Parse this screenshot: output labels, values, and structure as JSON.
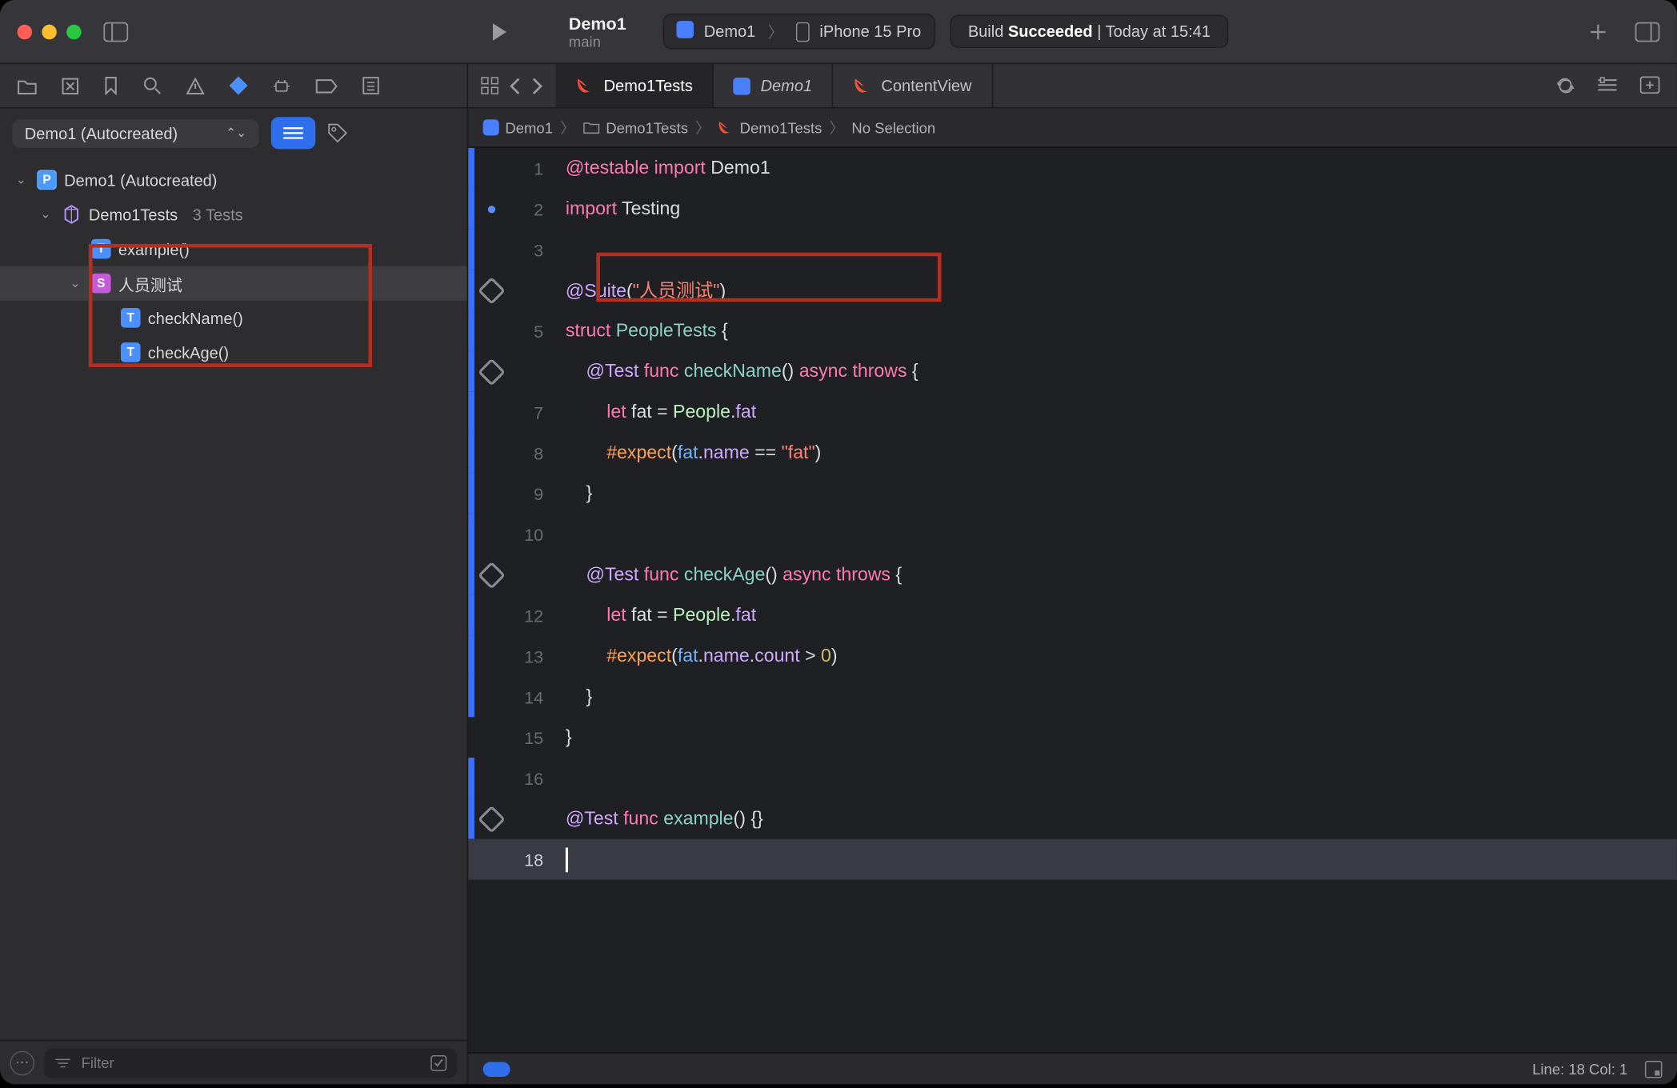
{
  "window": {
    "project": "Demo1",
    "branch": "main"
  },
  "scheme": {
    "target": "Demo1",
    "device": "iPhone 15 Pro"
  },
  "build_status": {
    "prefix": "Build ",
    "result": "Succeeded",
    "when": " | Today at 15:41"
  },
  "nav_dropdown": "Demo1 (Autocreated)",
  "tests_tree": {
    "root": "Demo1 (Autocreated)",
    "target": "Demo1Tests",
    "target_count": "3 Tests",
    "items": {
      "example": "example()",
      "suite": "人员测试",
      "checkName": "checkName()",
      "checkAge": "checkAge()"
    }
  },
  "filter_placeholder": "Filter",
  "editor_tabs": {
    "t0": "Demo1Tests",
    "t1": "Demo1",
    "t2": "ContentView"
  },
  "breadcrumb": {
    "c0": "Demo1",
    "c1": "Demo1Tests",
    "c2": "Demo1Tests",
    "c3": "No Selection"
  },
  "code": {
    "l1a": "@testable ",
    "l1b": "import ",
    "l1c": "Demo1",
    "l2a": "import ",
    "l2b": "Testing",
    "l4a": "@Suite",
    "l4b": "(",
    "l4c": "\"人员测试\"",
    "l4d": ")",
    "l5a": "struct ",
    "l5b": "PeopleTests",
    "l5c": " {",
    "l6a": "    ",
    "l6b": "@Test",
    "l6c": " ",
    "l6d": "func ",
    "l6e": "checkName",
    "l6f": "() ",
    "l6g": "async ",
    "l6h": "throws ",
    "l6i": "{",
    "l7a": "        ",
    "l7b": "let ",
    "l7c": "fat = ",
    "l7d": "People",
    "l7e": ".",
    "l7f": "fat",
    "l8a": "        ",
    "l8b": "#expect",
    "l8c": "(",
    "l8d": "fat",
    "l8e": ".",
    "l8f": "name",
    "l8g": " == ",
    "l8h": "\"fat\"",
    "l8i": ")",
    "l9": "    }",
    "l11a": "    ",
    "l11b": "@Test",
    "l11c": " ",
    "l11d": "func ",
    "l11e": "checkAge",
    "l11f": "() ",
    "l11g": "async ",
    "l11h": "throws ",
    "l11i": "{",
    "l12a": "        ",
    "l12b": "let ",
    "l12c": "fat = ",
    "l12d": "People",
    "l12e": ".",
    "l12f": "fat",
    "l13a": "        ",
    "l13b": "#expect",
    "l13c": "(",
    "l13d": "fat",
    "l13e": ".",
    "l13f": "name",
    "l13g": ".",
    "l13h": "count",
    "l13i": " > ",
    "l13j": "0",
    "l13k": ")",
    "l14": "    }",
    "l15": "}",
    "l17a": "@Test",
    "l17b": " ",
    "l17c": "func ",
    "l17d": "example",
    "l17e": "() {}",
    "ln1": "1",
    "ln2": "2",
    "ln3": "3",
    "ln5": "5",
    "ln7": "7",
    "ln8": "8",
    "ln9": "9",
    "ln10": "10",
    "ln12": "12",
    "ln13": "13",
    "ln14": "14",
    "ln15": "15",
    "ln16": "16",
    "ln18": "18"
  },
  "status_line": "Line: 18  Col: 1"
}
